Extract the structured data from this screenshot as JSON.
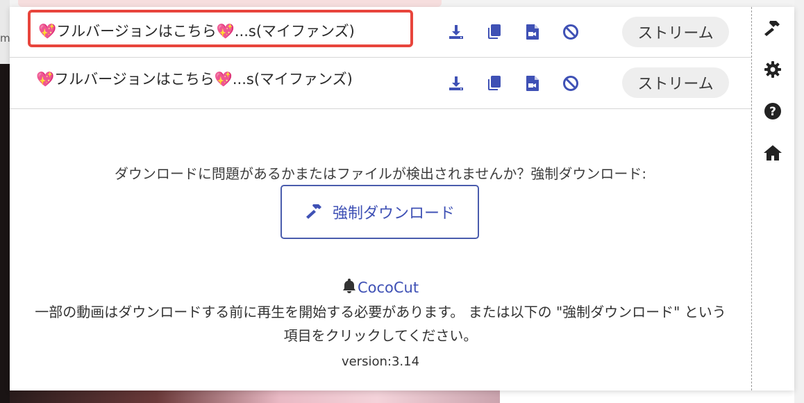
{
  "background": {
    "left_char": "m"
  },
  "downloads": [
    {
      "title": "💖フルバージョンはこちら💖...s(マイファンズ)",
      "stream_label": "ストリーム",
      "highlighted": true
    },
    {
      "title": "💖フルバージョンはこちら💖...s(マイファンズ)",
      "stream_label": "ストリーム",
      "highlighted": false
    }
  ],
  "row_action_icons": [
    "download-icon",
    "copy-icon",
    "video-file-icon",
    "block-icon"
  ],
  "prompt": "ダウンロードに問題があるかまたはファイルが検出されませんか？強制ダウンロード:",
  "force_button_label": "強制ダウンロード",
  "brand_name": "CocoCut",
  "note": "一部の動画はダウンロードする前に再生を開始する必要があります。 または以下の \"強制ダウンロード\" という項目をクリックしてください。",
  "version": "version:3.14",
  "sidebar_icons": [
    "hammer-icon",
    "gear-icon",
    "help-icon",
    "home-icon"
  ],
  "colors": {
    "accent": "#3f51b5",
    "highlight_border": "#e8453c",
    "stream_bg": "#eeeeee"
  }
}
